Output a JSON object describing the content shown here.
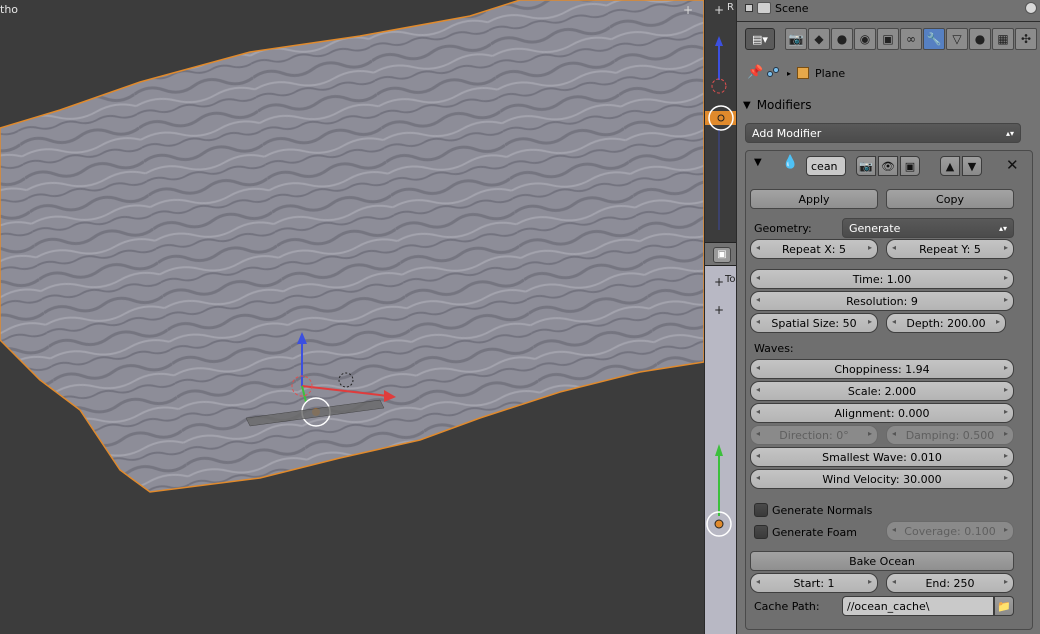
{
  "viewport": {
    "header_text": "tho",
    "corner_plus": "+"
  },
  "midstrip": {
    "top_label": "R",
    "lower_label": "To",
    "plus": "+"
  },
  "outliner": {
    "scene_label": "Scene"
  },
  "properties": {
    "tabs": [
      "render-icon",
      "layers-icon",
      "scene-icon",
      "world-icon",
      "object-icon",
      "constraints-icon",
      "modifiers-icon",
      "data-icon",
      "material-icon",
      "texture-icon",
      "particles-icon",
      "physics-icon"
    ],
    "active_tab": "modifiers-icon",
    "breadcrumb_object": "Plane",
    "panel_title": "Modifiers",
    "add_modifier_label": "Add Modifier",
    "modifier": {
      "name": "cean",
      "apply_label": "Apply",
      "copy_label": "Copy",
      "geometry_label": "Geometry:",
      "geometry_value": "Generate",
      "repeat_x": "Repeat X: 5",
      "repeat_y": "Repeat Y: 5",
      "time": "Time: 1.00",
      "resolution": "Resolution: 9",
      "spatial_size": "Spatial Size: 50",
      "depth": "Depth: 200.00",
      "waves_label": "Waves:",
      "choppiness": "Choppiness: 1.94",
      "scale": "Scale: 2.000",
      "alignment": "Alignment: 0.000",
      "direction": "Direction: 0°",
      "damping": "Damping: 0.500",
      "smallest_wave": "Smallest Wave: 0.010",
      "wind_velocity": "Wind Velocity: 30.000",
      "generate_normals": "Generate Normals",
      "generate_foam": "Generate Foam",
      "coverage": "Coverage: 0.100",
      "bake_ocean": "Bake Ocean",
      "start": "Start: 1",
      "end": "End: 250",
      "cache_path_label": "Cache Path:",
      "cache_path_value": "//ocean_cache\\"
    }
  },
  "colors": {
    "active_tab": "#5680c2",
    "selection_outline": "#e08a2c",
    "axis_x": "#e03c3c",
    "axis_y": "#3cc03c",
    "axis_z": "#3c50e0"
  }
}
